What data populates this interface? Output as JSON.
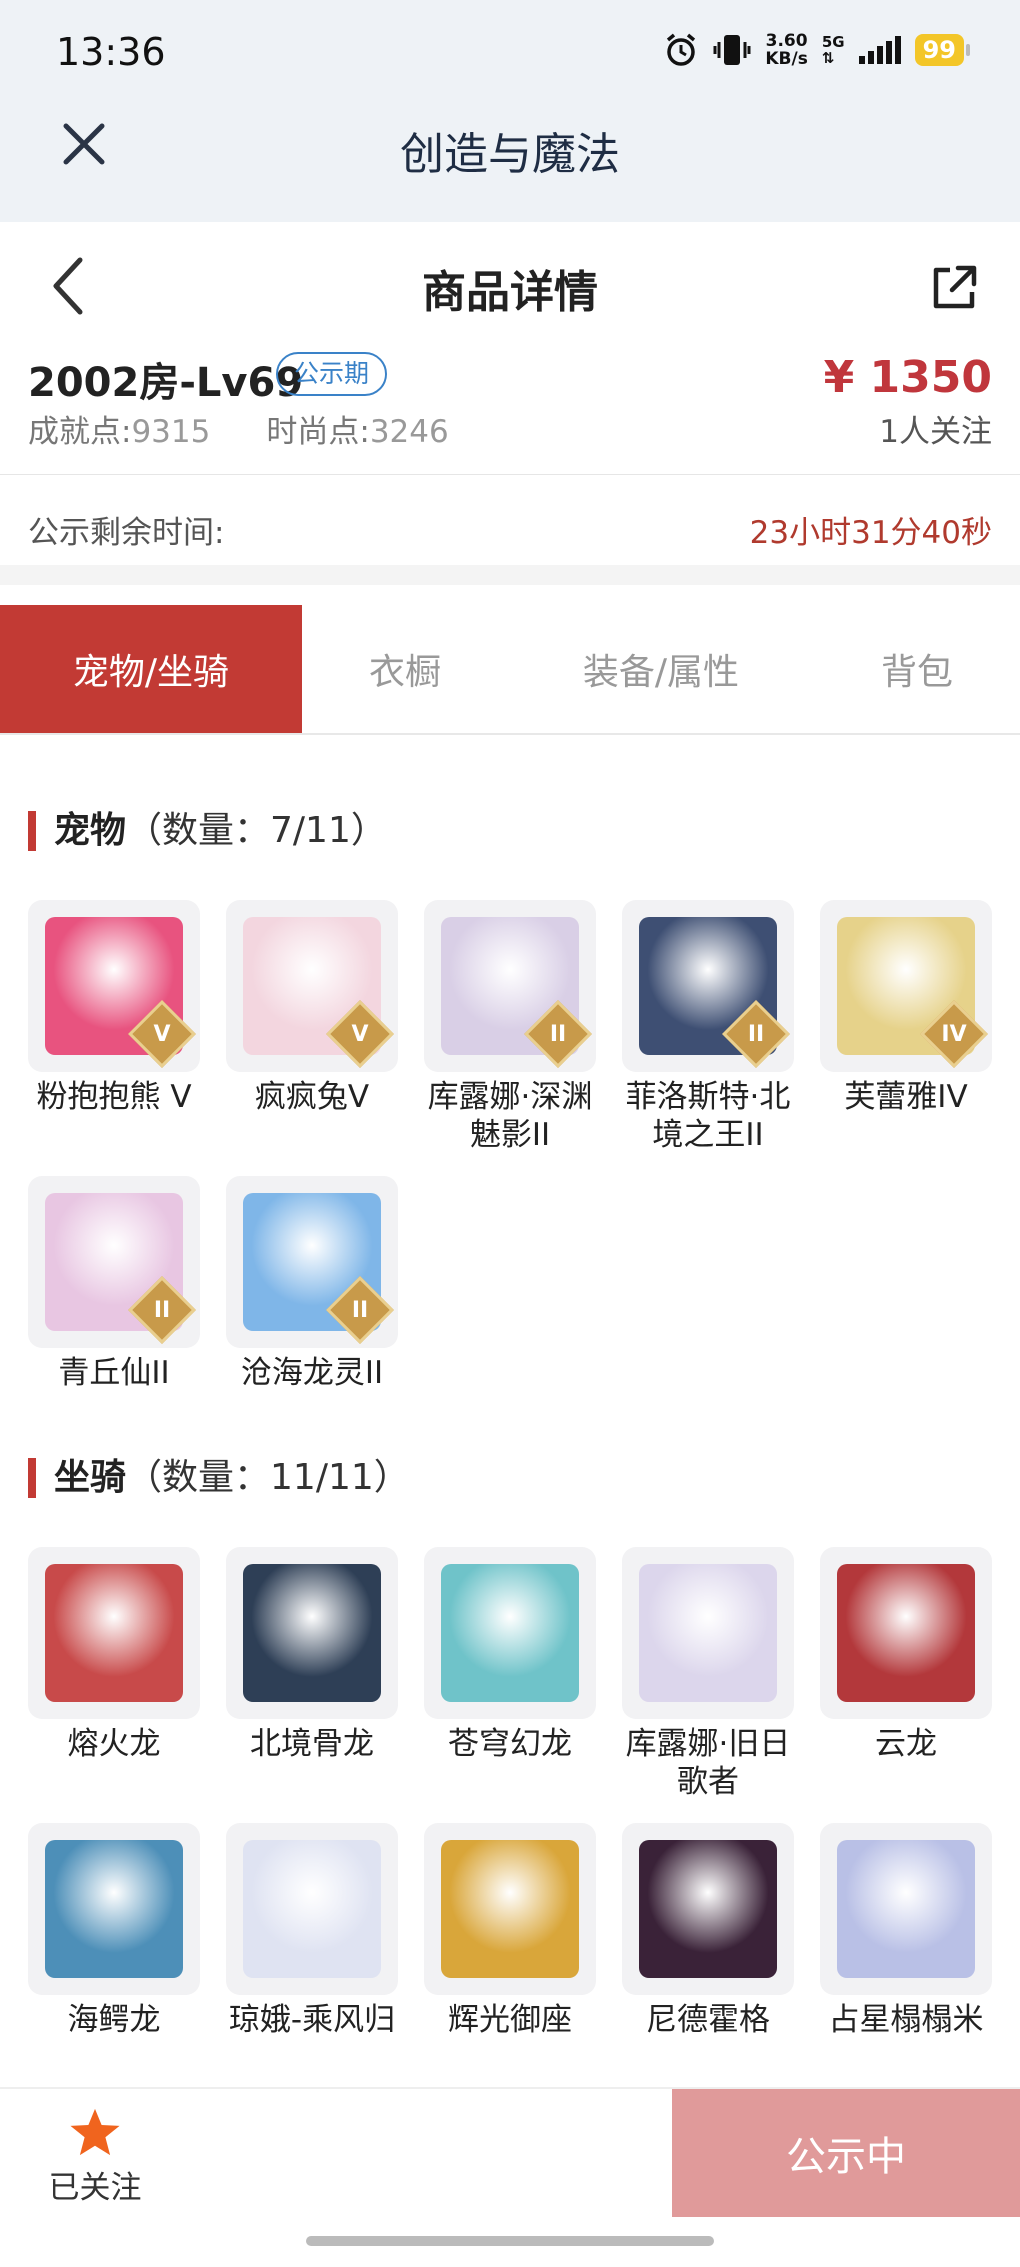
{
  "status_bar": {
    "time": "13:36",
    "speed_value": "3.60",
    "speed_unit": "KB/s",
    "network": "5G",
    "battery": "99",
    "icons": [
      "alarm-icon",
      "vibrate-icon",
      "signal-icon",
      "battery-icon"
    ]
  },
  "app_header": {
    "title": "创造与魔法",
    "close_icon": "close-icon"
  },
  "detail_header": {
    "title": "商品详情",
    "back_icon": "chevron-left-icon",
    "share_icon": "share-icon"
  },
  "product": {
    "server": "2002房-Lv69",
    "status_tag": "公示期",
    "price": "¥ 1350",
    "achievement_label": "成就点:",
    "achievement_value": "9315",
    "fashion_label": "时尚点:",
    "fashion_value": "3246",
    "followers": "1人关注",
    "remain_label": "公示剩余时间:",
    "remain_value": "23小时31分40秒"
  },
  "tabs": [
    {
      "label": "宠物/坐骑",
      "active": true
    },
    {
      "label": "衣橱",
      "active": false
    },
    {
      "label": "装备/属性",
      "active": false
    },
    {
      "label": "背包",
      "active": false
    }
  ],
  "pets": {
    "title": "宠物",
    "count": "（数量：7/11）",
    "items": [
      {
        "name": "粉抱抱熊 V",
        "rank": "V",
        "color": "#e8537f"
      },
      {
        "name": "疯疯兔V",
        "rank": "V",
        "color": "#f3d6df"
      },
      {
        "name": "库露娜·深渊魅影II",
        "rank": "II",
        "color": "#d9cfe6"
      },
      {
        "name": "菲洛斯特·北境之王II",
        "rank": "II",
        "color": "#3e4f73"
      },
      {
        "name": "芙蕾雅IV",
        "rank": "IV",
        "color": "#e6d28a"
      },
      {
        "name": "青丘仙II",
        "rank": "II",
        "color": "#e8c6e2"
      },
      {
        "name": "沧海龙灵II",
        "rank": "II",
        "color": "#7fb6e8"
      }
    ]
  },
  "mounts": {
    "title": "坐骑",
    "count": "（数量：11/11）",
    "items": [
      {
        "name": "熔火龙",
        "color": "#c84a4a"
      },
      {
        "name": "北境骨龙",
        "color": "#2e3f56"
      },
      {
        "name": "苍穹幻龙",
        "color": "#6fc3c9"
      },
      {
        "name": "库露娜·旧日歌者",
        "color": "#dcd6ec"
      },
      {
        "name": "云龙",
        "color": "#b3383b"
      },
      {
        "name": "海鳄龙",
        "color": "#4d8fb8"
      },
      {
        "name": "琼娥-乘风归",
        "color": "#dfe3f2"
      },
      {
        "name": "辉光御座",
        "color": "#d9a63a"
      },
      {
        "name": "尼德霍格",
        "color": "#3a2238"
      },
      {
        "name": "占星榻榻米",
        "color": "#b9c0e6"
      }
    ]
  },
  "bottom_bar": {
    "follow_label": "已关注",
    "action_label": "公示中",
    "star_color": "#f0641e"
  }
}
